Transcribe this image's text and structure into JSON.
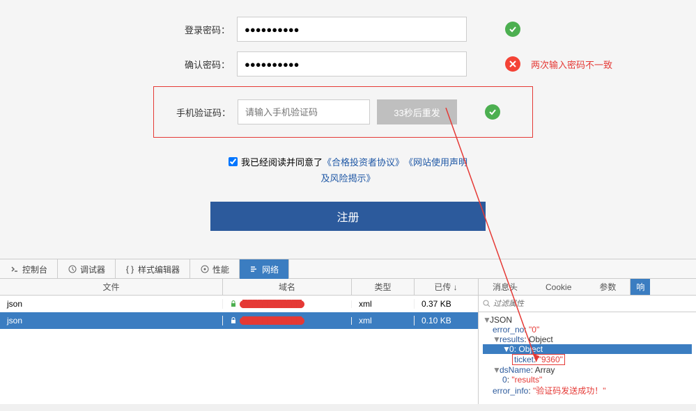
{
  "form": {
    "password_label": "登录密码：",
    "password_value": "●●●●●●●●●●",
    "confirm_label": "确认密码：",
    "confirm_value": "●●●●●●●●●●",
    "confirm_error": "两次输入密码不一致",
    "captcha_label": "手机验证码：",
    "captcha_placeholder": "请输入手机验证码",
    "resend_label": "33秒后重发",
    "agree_prefix": "我已经阅读并同意了",
    "agree_link1": "《合格投资者协议》",
    "agree_link2": "《网站使用声明",
    "agree_link2b": "及风险揭示》",
    "submit": "注册"
  },
  "devtools": {
    "tabs": {
      "console": "控制台",
      "debugger": "调试器",
      "style": "样式编辑器",
      "perf": "性能",
      "network": "网络"
    },
    "cols": {
      "file": "文件",
      "domain": "域名",
      "type": "类型",
      "size": "已传"
    },
    "rows": [
      {
        "file": "json",
        "domain": "████████████",
        "type": "xml",
        "size": "0.37 KB"
      },
      {
        "file": "json",
        "domain": "████████████",
        "type": "xml",
        "size": "0.10 KB"
      }
    ],
    "right_tabs": {
      "headers": "消息头",
      "cookie": "Cookie",
      "params": "参数",
      "resp": "响"
    },
    "filter_placeholder": "过滤属性",
    "json": {
      "label_json": "JSON",
      "error_no_key": "error_no",
      "error_no_val": "\"0\"",
      "results_key": "results",
      "results_val": "Object",
      "zero_key": "0",
      "zero_val": "Object",
      "ticket_key": "ticket",
      "ticket_val": "\"9360\"",
      "dsname_key": "dsName",
      "dsname_val": "Array",
      "dsname_0_key": "0",
      "dsname_0_val": "\"results\"",
      "error_info_key": "error_info",
      "error_info_val": "\"验证码发送成功！\""
    }
  }
}
